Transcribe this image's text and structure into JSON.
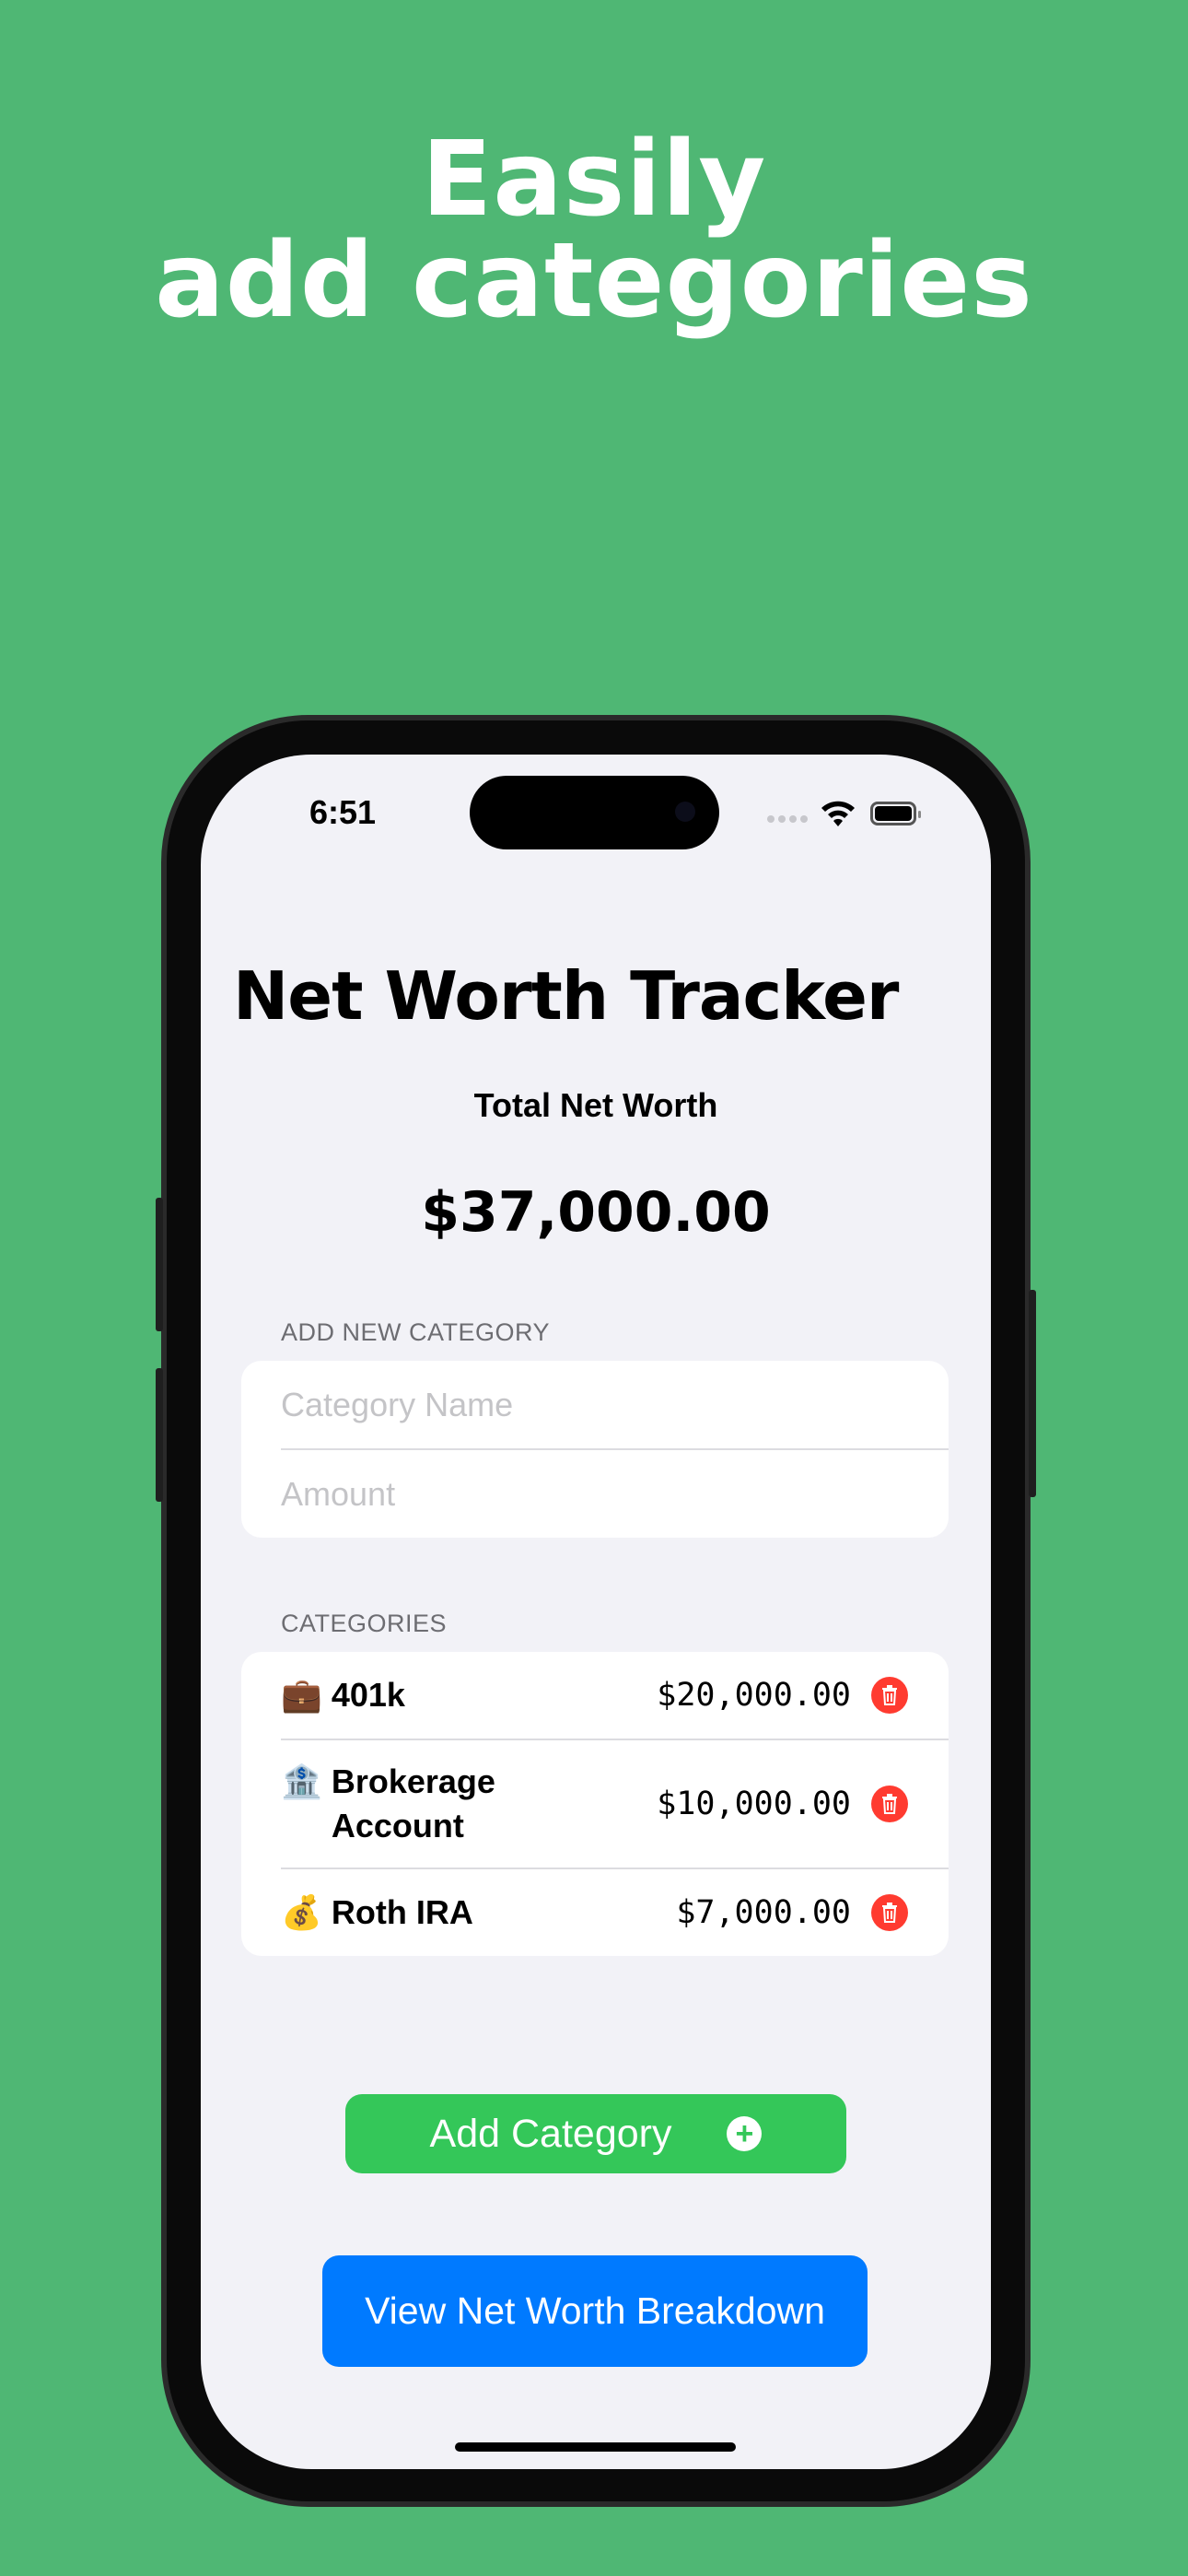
{
  "headline": {
    "line1": "Easily",
    "line2": "add categories"
  },
  "status_bar": {
    "time": "6:51"
  },
  "app": {
    "title": "Net Worth Tracker",
    "total_label": "Total Net Worth",
    "total_value": "$37,000.00",
    "add_section": {
      "header": "ADD NEW CATEGORY",
      "name_placeholder": "Category Name",
      "amount_placeholder": "Amount"
    },
    "categories_section": {
      "header": "CATEGORIES",
      "items": [
        {
          "emoji": "💼",
          "name": "401k",
          "amount": "$20,000.00"
        },
        {
          "emoji": "🏦",
          "name": "Brokerage Account",
          "amount": "$10,000.00"
        },
        {
          "emoji": "💰",
          "name": "Roth IRA",
          "amount": "$7,000.00"
        }
      ]
    },
    "add_button": "Add Category",
    "view_button": "View Net Worth Breakdown"
  },
  "colors": {
    "background": "#4fb774",
    "green": "#34c759",
    "blue": "#007aff",
    "delete": "#ff3b30"
  }
}
